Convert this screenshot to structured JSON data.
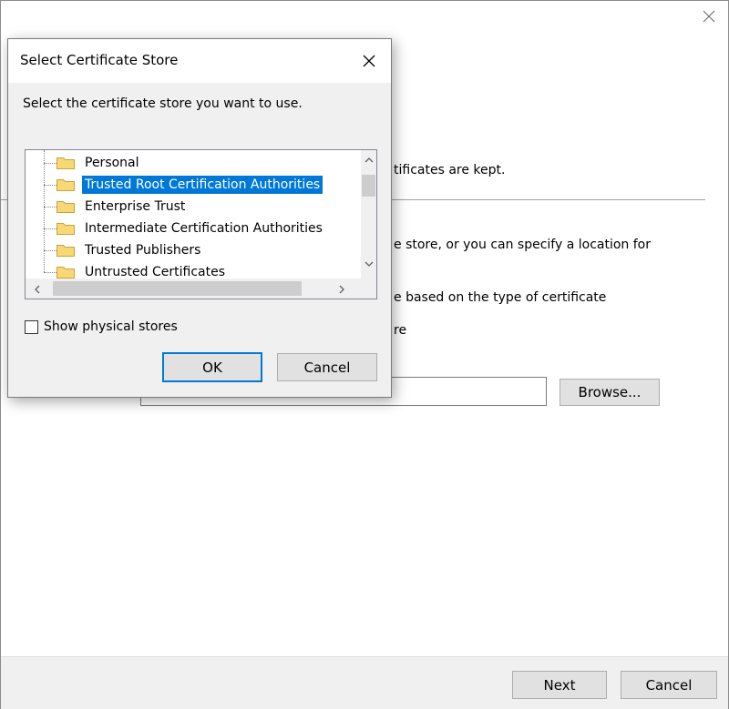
{
  "wizard": {
    "close_icon": "close-icon",
    "text_line1": "tificates are kept.",
    "text_line2": "e store, or you can specify a location for",
    "text_line3": "e based on the type of certificate",
    "text_line4": "re",
    "browse_label": "Browse...",
    "next_label": "Next",
    "cancel_label": "Cancel"
  },
  "dialog": {
    "title": "Select Certificate Store",
    "prompt": "Select the certificate store you want to use.",
    "stores": [
      {
        "label": "Personal",
        "selected": false
      },
      {
        "label": "Trusted Root Certification Authorities",
        "selected": true
      },
      {
        "label": "Enterprise Trust",
        "selected": false
      },
      {
        "label": "Intermediate Certification Authorities",
        "selected": false
      },
      {
        "label": "Trusted Publishers",
        "selected": false
      },
      {
        "label": "Untrusted Certificates",
        "selected": false
      }
    ],
    "show_physical_label": "Show physical stores",
    "show_physical_checked": false,
    "ok_label": "OK",
    "cancel_label": "Cancel"
  },
  "colors": {
    "accent": "#0078d7",
    "folder": "#f8d775",
    "dialog_bg": "#f0f0f0"
  }
}
